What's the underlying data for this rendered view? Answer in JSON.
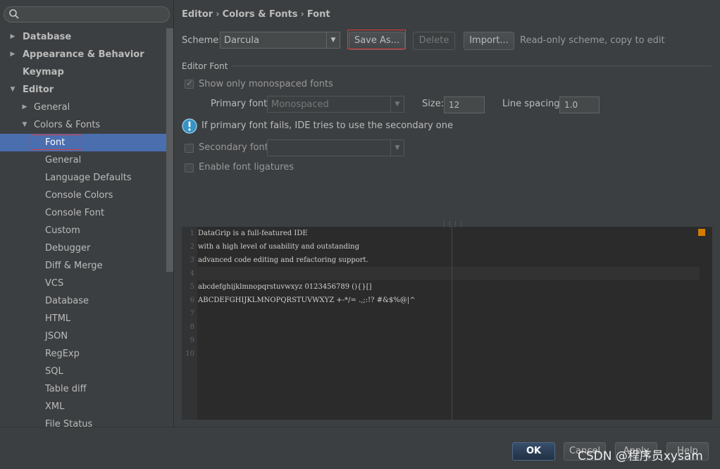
{
  "search": {
    "placeholder": ""
  },
  "sidebar": {
    "items": [
      {
        "label": "Database",
        "level": 0,
        "arrow": "collapsed",
        "bold": true
      },
      {
        "label": "Appearance & Behavior",
        "level": 0,
        "arrow": "collapsed",
        "bold": true
      },
      {
        "label": "Keymap",
        "level": 0,
        "arrow": "none",
        "bold": true
      },
      {
        "label": "Editor",
        "level": 0,
        "arrow": "expanded",
        "bold": true
      },
      {
        "label": "General",
        "level": 1,
        "arrow": "collapsed",
        "bold": false
      },
      {
        "label": "Colors & Fonts",
        "level": 1,
        "arrow": "expanded",
        "bold": false
      },
      {
        "label": "Font",
        "level": 2,
        "arrow": "none",
        "bold": false,
        "selected": true
      },
      {
        "label": "General",
        "level": 2,
        "arrow": "none",
        "bold": false
      },
      {
        "label": "Language Defaults",
        "level": 2,
        "arrow": "none",
        "bold": false
      },
      {
        "label": "Console Colors",
        "level": 2,
        "arrow": "none",
        "bold": false
      },
      {
        "label": "Console Font",
        "level": 2,
        "arrow": "none",
        "bold": false
      },
      {
        "label": "Custom",
        "level": 2,
        "arrow": "none",
        "bold": false
      },
      {
        "label": "Debugger",
        "level": 2,
        "arrow": "none",
        "bold": false
      },
      {
        "label": "Diff & Merge",
        "level": 2,
        "arrow": "none",
        "bold": false
      },
      {
        "label": "VCS",
        "level": 2,
        "arrow": "none",
        "bold": false
      },
      {
        "label": "Database",
        "level": 2,
        "arrow": "none",
        "bold": false
      },
      {
        "label": "HTML",
        "level": 2,
        "arrow": "none",
        "bold": false
      },
      {
        "label": "JSON",
        "level": 2,
        "arrow": "none",
        "bold": false
      },
      {
        "label": "RegExp",
        "level": 2,
        "arrow": "none",
        "bold": false
      },
      {
        "label": "SQL",
        "level": 2,
        "arrow": "none",
        "bold": false
      },
      {
        "label": "Table diff",
        "level": 2,
        "arrow": "none",
        "bold": false
      },
      {
        "label": "XML",
        "level": 2,
        "arrow": "none",
        "bold": false
      },
      {
        "label": "File Status",
        "level": 2,
        "arrow": "none",
        "bold": false
      }
    ]
  },
  "breadcrumb": {
    "part1": "Editor",
    "part2": "Colors & Fonts",
    "part3": "Font",
    "separator": "›"
  },
  "scheme": {
    "label": "Scheme:",
    "value": "Darcula",
    "save_as_label": "Save As...",
    "delete_label": "Delete",
    "import_label": "Import...",
    "note": "Read-only scheme, copy to edit"
  },
  "editor_font": {
    "group_title": "Editor Font",
    "monospaced_label": "Show only monospaced fonts",
    "monospaced_checked": true,
    "primary_font_label": "Primary font:",
    "primary_font_value": "Monospaced",
    "size_label": "Size:",
    "size_value": "12",
    "line_spacing_label": "Line spacing:",
    "line_spacing_value": "1.0",
    "info_text": "If primary font fails, IDE tries to use the secondary one",
    "secondary_font_label": "Secondary font:",
    "secondary_font_value": "",
    "secondary_checked": false,
    "ligatures_label": "Enable font ligatures",
    "ligatures_checked": false
  },
  "preview": {
    "lines": [
      {
        "num": "1",
        "text": "DataGrip is a full-featured IDE"
      },
      {
        "num": "2",
        "text": "with a high level of usability and outstanding"
      },
      {
        "num": "3",
        "text": "advanced code editing and refactoring support."
      },
      {
        "num": "4",
        "text": ""
      },
      {
        "num": "5",
        "text": "abcdefghijklmnopqrstuvwxyz 0123456789 (){}[]"
      },
      {
        "num": "6",
        "text": "ABCDEFGHIJKLMNOPQRSTUVWXYZ +-*/= .,;:!? #&$%@|^"
      },
      {
        "num": "7",
        "text": ""
      },
      {
        "num": "8",
        "text": ""
      },
      {
        "num": "9",
        "text": ""
      },
      {
        "num": "10",
        "text": ""
      }
    ]
  },
  "footer": {
    "ok_label": "OK",
    "cancel_label": "Cancel",
    "apply_label": "Apply",
    "help_label": "Help"
  },
  "watermark": "CSDN @程序员xysam",
  "colors": {
    "background": "#3c3f41",
    "selection": "#4b6eaf",
    "editor_bg": "#2b2b2b",
    "highlight_outline": "#e0393e",
    "marker": "#d37c00"
  }
}
